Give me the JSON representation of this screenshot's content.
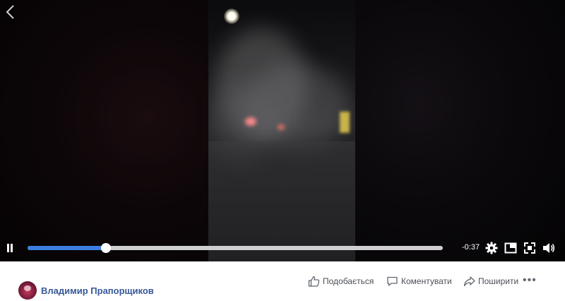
{
  "player": {
    "time_remaining": "-0:37",
    "progress_fraction": 0.189,
    "accent_color": "#3b7de0",
    "icons": [
      "back-arrow-icon",
      "pause-icon",
      "settings-gear-icon",
      "picture-in-picture-icon",
      "fullscreen-icon",
      "volume-icon"
    ]
  },
  "post": {
    "author": "Владимир Прапорщиков",
    "actions": {
      "like_label": "Подобається",
      "comment_label": "Коментувати",
      "share_label": "Поширити",
      "more_label": "•••"
    },
    "link_color": "#385898"
  }
}
